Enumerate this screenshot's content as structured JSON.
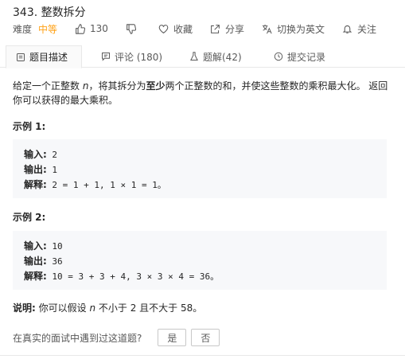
{
  "problem": {
    "title": "343. 整数拆分",
    "difficulty_label": "难度",
    "difficulty": "中等",
    "likes": "130",
    "favorite_label": "收藏",
    "share_label": "分享",
    "switch_lang_label": "切换为英文",
    "follow_label": "关注"
  },
  "tabs": [
    {
      "label": "题目描述"
    },
    {
      "label": "评论 (180)"
    },
    {
      "label": "题解(42)"
    },
    {
      "label": "提交记录"
    }
  ],
  "description": {
    "p1": "给定一个正整数 ",
    "n": "n",
    "p2": "，将其拆分为",
    "bold": "至少",
    "p3": "两个正整数的和，并使这些整数的乘积最大化。 返回你可以获得的最大乘积。"
  },
  "examples": [
    {
      "title": "示例 1:",
      "input_label": "输入:",
      "input": " 2",
      "output_label": "输出:",
      "output": " 1",
      "explain_label": "解释:",
      "explain": " 2 = 1 + 1, 1 × 1 = 1。"
    },
    {
      "title": "示例 2:",
      "input_label": "输入:",
      "input": " 10",
      "output_label": "输出:",
      "output": " 36",
      "explain_label": "解释:",
      "explain": " 10 = 3 + 3 + 4, 3 × 3 × 4 = 36。"
    }
  ],
  "note": {
    "label": "说明:",
    "t1": " 你可以假设 ",
    "n": "n",
    "t2": " 不小于 2 且不大于 58。"
  },
  "survey": {
    "question": "在真实的面试中遇到过这道题?",
    "yes": "是",
    "no": "否"
  },
  "colors": {
    "accent": "#ffa116",
    "text": "#262626",
    "muted": "#595959",
    "code_bg": "#f7f8fa"
  }
}
